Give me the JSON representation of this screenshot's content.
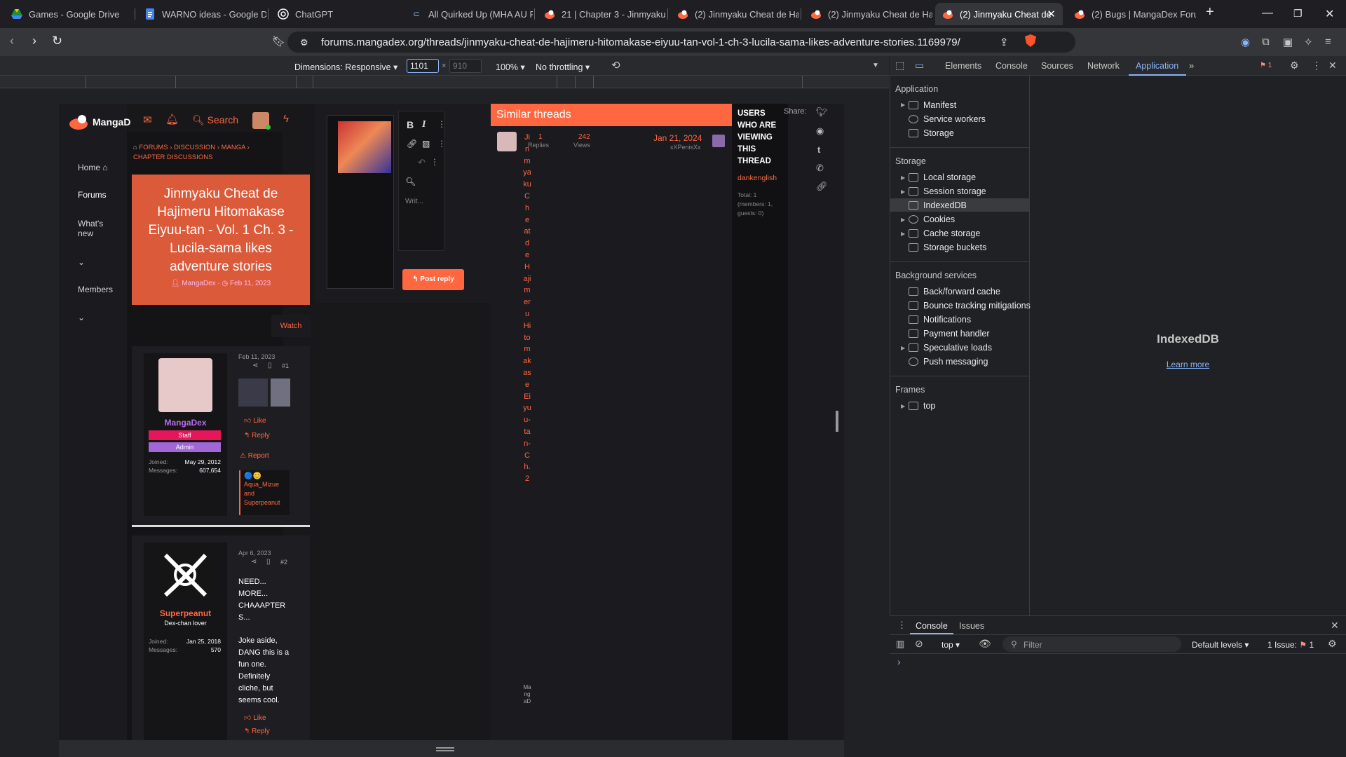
{
  "browser": {
    "tabs": [
      {
        "label": "Games - Google Drive",
        "icon": "google-drive-icon"
      },
      {
        "label": "WARNO ideas - Google Dc",
        "icon": "google-docs-icon"
      },
      {
        "label": "ChatGPT",
        "icon": "chatgpt-icon"
      },
      {
        "label": "All Quirked Up (MHA AU F",
        "icon": "ao3-icon"
      },
      {
        "label": "21 | Chapter 3 - Jinmyaku (",
        "icon": "mangadex-icon"
      },
      {
        "label": "(2) Jinmyaku Cheat de Haj",
        "icon": "mangadex-icon"
      },
      {
        "label": "(2) Jinmyaku Cheat de Haj",
        "icon": "mangadex-icon"
      },
      {
        "label": "(2) Jinmyaku Cheat de",
        "icon": "mangadex-icon"
      },
      {
        "label": "(2) Bugs | MangaDex Forur",
        "icon": "mangadex-icon"
      }
    ],
    "url": "forums.mangadex.org/threads/jinmyaku-cheat-de-hajimeru-hitomakase-eiyuu-tan-vol-1-ch-3-lucila-sama-likes-adventure-stories.1169979/"
  },
  "device_toolbar": {
    "dimensions_label": "Dimensions: Responsive",
    "width": "1101",
    "height": "910",
    "zoom": "100%",
    "throttle": "No throttling"
  },
  "devtools": {
    "tabs": [
      "Elements",
      "Console",
      "Sources",
      "Network",
      "Application"
    ],
    "issue_count": "1",
    "application_header": "Application",
    "application_items": [
      "Manifest",
      "Service workers",
      "Storage"
    ],
    "storage_header": "Storage",
    "storage_items": [
      "Local storage",
      "Session storage",
      "IndexedDB",
      "Cookies",
      "Cache storage",
      "Storage buckets"
    ],
    "background_header": "Background services",
    "background_items": [
      "Back/forward cache",
      "Bounce tracking mitigations",
      "Notifications",
      "Payment handler",
      "Speculative loads",
      "Push messaging"
    ],
    "frames_header": "Frames",
    "frames_items": [
      "top"
    ],
    "main_title": "IndexedDB",
    "learn_more": "Learn more",
    "drawer_tabs": [
      "Console",
      "Issues"
    ],
    "console_context": "top",
    "filter_placeholder": "Filter",
    "levels": "Default levels",
    "issues_label": "1 Issue:",
    "issues_count": "1",
    "prompt": "›"
  },
  "site": {
    "logo": "MangaD",
    "search": "Search",
    "nav": [
      "Home",
      "Forums",
      "What's new",
      "Members"
    ],
    "breadcrumb": [
      "FORUMS",
      "DISCUSSION",
      "MANGA",
      "CHAPTER DISCUSSIONS"
    ],
    "thread_title": "Jinmyaku Cheat de Hajimeru Hitomakase Eiyuu-tan - Vol. 1 Ch. 3 - Lucila-sama likes adventure stories",
    "thread_author": "MangaDex",
    "thread_date": "Feb 11, 2023",
    "watch": "Watch",
    "editor_placeholder": "Writ...",
    "post_reply": "Post reply",
    "posts": [
      {
        "author": "MangaDex",
        "badges": [
          "Staff",
          "Admin"
        ],
        "joined_label": "Joined:",
        "joined": "May 29, 2012",
        "messages_label": "Messages:",
        "messages": "607,654",
        "date": "Feb 11, 2023",
        "num": "#1",
        "like": "Like",
        "reply": "Reply",
        "report": "Report",
        "reactors": "Aqua_Mizue and Superpeanut"
      },
      {
        "author": "Superpeanut",
        "title": "Dex-chan lover",
        "joined_label": "Joined:",
        "joined": "Jan 25, 2018",
        "messages_label": "Messages:",
        "messages": "570",
        "date": "Apr 6, 2023",
        "num": "#2",
        "text1": "NEED... MORE... CHAAAPTER S...",
        "text2": "Joke aside, DANG this is a fun one. Definitely cliche, but seems cool.",
        "like": "Like",
        "reply": "Reply"
      }
    ],
    "similar": {
      "header": "Similar threads",
      "title_vertical": "JinmyakuCheatdeHajimeruHitomakaseEiyuu-tan-Ch.2",
      "replies": "1",
      "replies_label": "Replies",
      "views": "242",
      "views_label": "Views",
      "date": "Jan 21, 2024",
      "user": "xXPenisXx",
      "tail_vertical": "MangaD"
    },
    "viewing": {
      "header": "USERS WHO ARE VIEWING THIS THREAD",
      "user": "dankenglish",
      "total": "Total: 1 (members: 1, guests: 0)"
    },
    "share": "Share:"
  },
  "colors": {
    "accent": "#ff6740",
    "staff": "#e5175a",
    "admin": "#a267d6",
    "devtools_blue": "#8ab4f8"
  }
}
